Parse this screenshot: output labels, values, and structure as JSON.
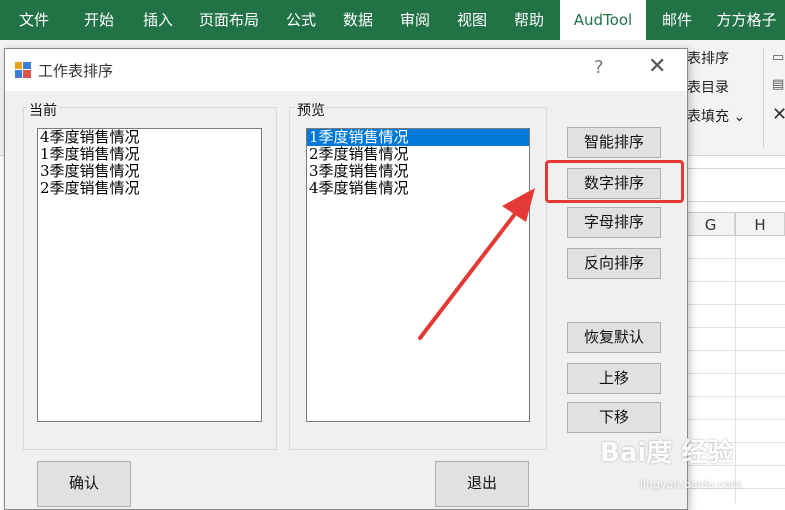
{
  "ribbon": {
    "tabs": [
      "文件",
      "开始",
      "插入",
      "页面布局",
      "公式",
      "数据",
      "审阅",
      "视图",
      "帮助",
      "AudTool",
      "邮件",
      "方方格子"
    ],
    "commands": {
      "sort_sheets": "表排序",
      "sheet_index": "表目录",
      "sheet_fill": "表填充 ⌄"
    }
  },
  "grid": {
    "columns": [
      "G",
      "H"
    ]
  },
  "dialog": {
    "title": "工作表排序",
    "help": "?",
    "close": "✕",
    "current": {
      "label": "当前",
      "items": [
        "4季度销售情况",
        "1季度销售情况",
        "3季度销售情况",
        "2季度销售情况"
      ]
    },
    "preview": {
      "label": "预览",
      "items": [
        "1季度销售情况",
        "2季度销售情况",
        "3季度销售情况",
        "4季度销售情况"
      ]
    },
    "buttons": {
      "smart_sort": "智能排序",
      "numeric_sort": "数字排序",
      "alpha_sort": "字母排序",
      "reverse_sort": "反向排序",
      "restore_default": "恢复默认",
      "move_up": "上移",
      "move_down": "下移",
      "confirm": "确认",
      "exit": "退出"
    }
  },
  "watermark": {
    "main": "Bai度 经验",
    "sub": "jingyan.baidu.com"
  },
  "colors": {
    "excel_green": "#217346",
    "highlight": "#e53935",
    "selection": "#0078d7"
  }
}
